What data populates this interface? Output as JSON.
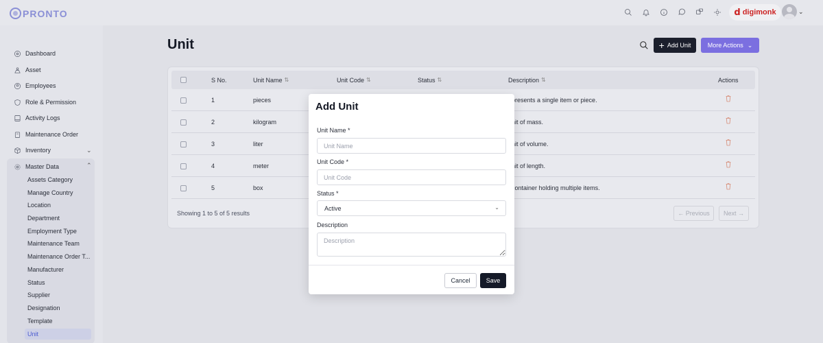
{
  "brand": {
    "app_name": "PRONTO",
    "company_name": "digimonk",
    "company_mark": "d"
  },
  "topbar": {
    "icons": [
      "search-icon",
      "bell-icon",
      "info-icon",
      "chat-icon",
      "translate-flag-icon",
      "sun-icon"
    ],
    "avatar_caret": "⌄"
  },
  "sidebar": {
    "items": [
      {
        "label": "Dashboard",
        "icon": "dashboard-icon"
      },
      {
        "label": "Asset",
        "icon": "asset-icon"
      },
      {
        "label": "Employees",
        "icon": "employees-icon"
      },
      {
        "label": "Role & Permission",
        "icon": "shield-icon"
      },
      {
        "label": "Activity Logs",
        "icon": "logs-icon"
      },
      {
        "label": "Maintenance Order",
        "icon": "clipboard-icon"
      },
      {
        "label": "Inventory",
        "icon": "cube-icon"
      },
      {
        "label": "Master Data",
        "icon": "gear-icon"
      }
    ],
    "carets": {
      "inventory": "⌄",
      "master_data": "⌃"
    },
    "master_data_items": [
      "Assets Category",
      "Manage Country",
      "Location",
      "Department",
      "Employment Type",
      "Maintenance Team",
      "Maintenance Order T...",
      "Manufacturer",
      "Status",
      "Supplier",
      "Designation",
      "Template",
      "Unit"
    ]
  },
  "page": {
    "title": "Unit",
    "add_button": "Add Unit",
    "add_plus": "+",
    "more_actions": "More Actions",
    "more_caret": "⌄"
  },
  "table": {
    "columns": [
      "S No.",
      "Unit Name",
      "Unit Code",
      "Status",
      "Description",
      "Actions"
    ],
    "sort_glyph": "⇅",
    "rows": [
      {
        "sno": "1",
        "name": "pieces",
        "description": "presents a single item or piece."
      },
      {
        "sno": "2",
        "name": "kilogram",
        "description": "nit of mass."
      },
      {
        "sno": "3",
        "name": "liter",
        "description": "nit of volume."
      },
      {
        "sno": "4",
        "name": "meter",
        "description": "nit of length."
      },
      {
        "sno": "5",
        "name": "box",
        "description": "container holding multiple items."
      }
    ],
    "showing": "Showing 1 to 5 of 5 results",
    "previous": "← Previous",
    "next": "Next →"
  },
  "modal": {
    "title": "Add Unit",
    "unit_name_label": "Unit Name",
    "unit_name_placeholder": "Unit Name",
    "unit_code_label": "Unit Code",
    "unit_code_placeholder": "Unit Code",
    "status_label": "Status",
    "status_value": "Active",
    "status_caret": "⌄",
    "description_label": "Description",
    "description_placeholder": "Description",
    "required_mark": "*",
    "cancel": "Cancel",
    "save": "Save"
  }
}
